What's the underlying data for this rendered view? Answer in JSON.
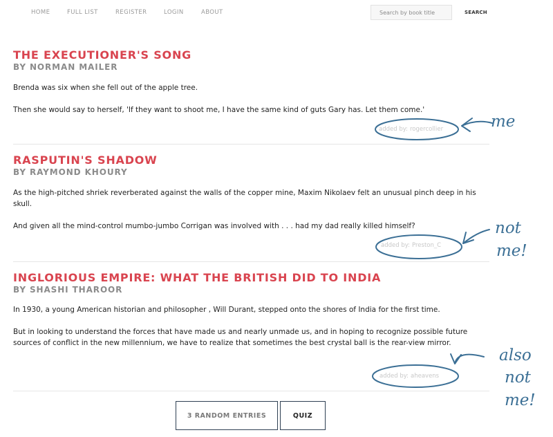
{
  "nav": {
    "items": [
      {
        "label": "HOME"
      },
      {
        "label": "FULL LIST"
      },
      {
        "label": "REGISTER"
      },
      {
        "label": "LOGIN"
      },
      {
        "label": "ABOUT"
      }
    ],
    "search": {
      "placeholder": "Search by book title",
      "value": "",
      "button_label": "SEARCH"
    }
  },
  "entries": [
    {
      "title": "THE EXECUTIONER'S SONG",
      "by_prefix": "BY",
      "author": "NORMAN MAILER",
      "paragraphs": [
        "Brenda was six when she fell out of the apple tree.",
        "Then she would say to herself, 'If they want to shoot me, I have the same kind of guts Gary has. Let them come.'"
      ],
      "added_label": "added by:",
      "added_by": "rogercollier"
    },
    {
      "title": "RASPUTIN'S SHADOW",
      "by_prefix": "BY",
      "author": "RAYMOND KHOURY",
      "paragraphs": [
        "As the high-pitched shriek reverberated against the walls of the copper mine, Maxim Nikolaev felt an unusual pinch deep in his skull.",
        "And given all the mind-control mumbo-jumbo Corrigan was involved with . . . had my dad really killed himself?"
      ],
      "added_label": "added by:",
      "added_by": "Preston_C"
    },
    {
      "title": "INGLORIOUS EMPIRE: WHAT THE BRITISH DID TO INDIA",
      "by_prefix": "BY",
      "author": "SHASHI THAROOR",
      "paragraphs": [
        "In 1930, a young American historian and philosopher , Will Durant, stepped onto the shores of India for the first time.",
        "But in looking to understand the forces that have made us and nearly unmade us, and in hoping to recognize possible future sources of conflict in the new millennium, we have to realize that sometimes the best crystal ball is the rear-view mirror."
      ],
      "added_label": "added by:",
      "added_by": "aheavens"
    }
  ],
  "annotations": {
    "note1": "me",
    "note2": [
      "not",
      "me!"
    ],
    "note3": [
      "also",
      "not",
      "me!"
    ]
  },
  "buttons": {
    "random": "3 RANDOM ENTRIES",
    "quiz": "QUIZ"
  },
  "colors": {
    "title": "#d9444f",
    "author": "#8b8b8b",
    "annotation_ink": "#3b6f95",
    "button_border": "#2e3f52"
  }
}
